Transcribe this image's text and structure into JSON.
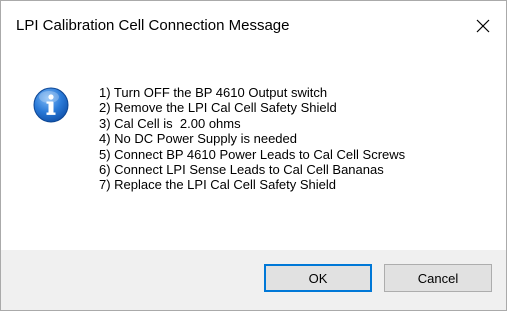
{
  "dialog": {
    "title": "LPI Calibration Cell Connection Message",
    "icon": "information-icon",
    "message_lines": [
      "1) Turn OFF the BP 4610 Output switch",
      "2) Remove the LPI Cal Cell Safety Shield",
      "3) Cal Cell is  2.00 ohms",
      "4) No DC Power Supply is needed",
      "5) Connect BP 4610 Power Leads to Cal Cell Screws",
      "6) Connect LPI Sense Leads to Cal Cell Bananas",
      "7) Replace the LPI Cal Cell Safety Shield"
    ],
    "buttons": {
      "ok_label": "OK",
      "cancel_label": "Cancel"
    }
  },
  "colors": {
    "accent": "#0078d7",
    "footer_bg": "#f0f0f0",
    "icon_blue": "#1e6cc7"
  }
}
